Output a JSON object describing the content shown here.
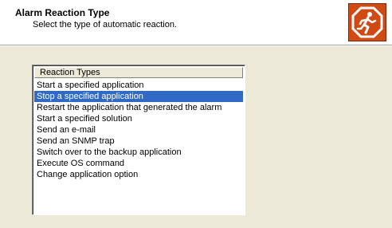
{
  "header": {
    "title": "Alarm Reaction Type",
    "subtitle": "Select the type of automatic reaction.",
    "icon": "stop-running-man-icon",
    "icon_color": "#d04a14"
  },
  "reaction_list": {
    "column_header": "Reaction Types",
    "selected_index": 1,
    "selected_color": "#316ac5",
    "items": [
      "Start a specified application",
      "Stop a specified application",
      "Restart the application that generated the alarm",
      "Start a specified solution",
      "Send an e-mail",
      "Send an SNMP trap",
      "Switch over to the backup application",
      "Execute OS command",
      "Change application option"
    ]
  }
}
